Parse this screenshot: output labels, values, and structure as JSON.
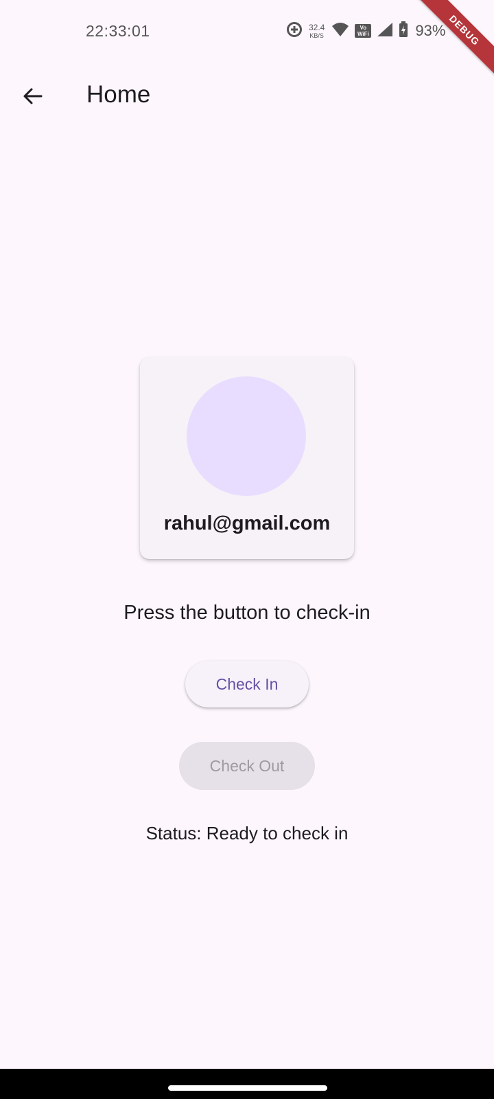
{
  "status_bar": {
    "time": "22:33:01",
    "net_speed_value": "32.4",
    "net_speed_unit": "KB/S",
    "vowifi_top": "Vo",
    "vowifi_bottom": "WiFi",
    "battery_percent": "93%"
  },
  "debug_banner": "DEBUG",
  "app_bar": {
    "title": "Home",
    "back_icon": "arrow-back-icon"
  },
  "profile": {
    "email": "rahul@gmail.com"
  },
  "prompt": "Press the button to check-in",
  "buttons": {
    "check_in": "Check In",
    "check_out": "Check Out"
  },
  "status": "Status: Ready to check in",
  "colors": {
    "background": "#fdf7fd",
    "primary": "#6750a4",
    "avatar": "#e9ddff",
    "card": "#f6f2f8",
    "disabled_button": "#e6e0e9",
    "debug_ribbon": "#b5353a"
  }
}
